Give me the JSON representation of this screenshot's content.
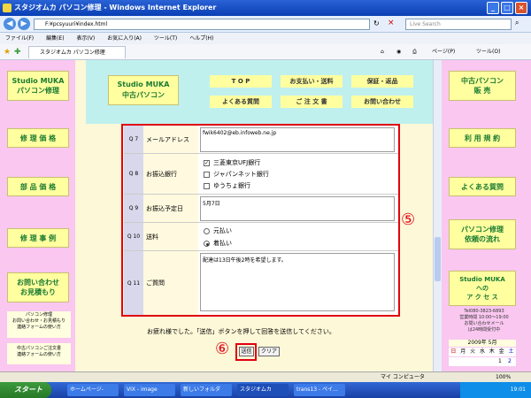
{
  "window": {
    "title": "スタジオムカ パソコン修理 - Windows Internet Explorer"
  },
  "address": {
    "url": "F:¥pcsyuuri¥index.html",
    "search_placeholder": "Live Search"
  },
  "menu": [
    "ファイル(F)",
    "編集(E)",
    "表示(V)",
    "お気に入り(A)",
    "ツール(T)",
    "ヘルプ(H)"
  ],
  "tab": {
    "label": "スタジオムカ パソコン修理"
  },
  "favtools": {
    "page": "ページ(P)",
    "tools": "ツール(O)"
  },
  "header": {
    "logo_line1": "Studio MUKA",
    "logo_line2": "中古パソコン",
    "nav": [
      "T O P",
      "お支払い・送料",
      "保証・返品",
      "よくある質問",
      "ご 注 文 書",
      "お問い合わせ"
    ]
  },
  "left": {
    "buttons": [
      "Studio MUKA\nパソコン修理",
      "修 理 価 格",
      "部 品 価 格",
      "修 理 事 例",
      "お問い合わせ\nお見積もり"
    ],
    "links": [
      "パソコン修理\nお問い合わせ・お見積もり\n連絡フォームの使い方",
      "中古パソコンご注文書\n連絡フォームの使い方"
    ]
  },
  "right": {
    "buttons": [
      "中古パソコン\n販 売",
      "利 用 規 約",
      "よくある質問",
      "パソコン修理\n依頼の流れ",
      "Studio MUKA\nへの\nア ク セ ス"
    ],
    "contact": "Tel080-3823-6893\n営業時間 10:00～19:00\nお問い合わせメール\nは24時間受付中",
    "calendar_title": "2009年 5月",
    "weekdays": [
      "日",
      "月",
      "火",
      "水",
      "木",
      "金",
      "土"
    ],
    "days": [
      "1",
      "2"
    ]
  },
  "form": {
    "q7": {
      "num": "Q 7",
      "label": "メールアドレス",
      "value": "fwik6402@eb.infoweb.ne.jp"
    },
    "q8": {
      "num": "Q 8",
      "label": "お振込銀行",
      "options": [
        "三菱東京UFJ銀行",
        "ジャパンネット銀行",
        "ゆうちょ銀行"
      ],
      "checked": "✓"
    },
    "q9": {
      "num": "Q 9",
      "label": "お振込予定日",
      "value": "5月7日"
    },
    "q10": {
      "num": "Q 10",
      "label": "送料",
      "options": [
        "元払い",
        "着払い"
      ]
    },
    "q11": {
      "num": "Q 11",
      "label": "ご質問",
      "value": "配達は13日午後2時を希望します。"
    }
  },
  "annotations": {
    "five": "⑤",
    "six": "⑥"
  },
  "instructions": "お疲れ様でした。「送信」ボタンを押して回答を送信してください。",
  "buttons": {
    "submit": "送信",
    "clear": "クリア"
  },
  "status": {
    "computer": "マイ コンピュータ",
    "zoom": "100%"
  },
  "taskbar": {
    "start": "スタート",
    "items": [
      "ホームページ-",
      "VIX - image",
      "新しいフォルダ",
      "スタジオムカ",
      "trans13 - ペイ..."
    ],
    "time": "19:01"
  }
}
